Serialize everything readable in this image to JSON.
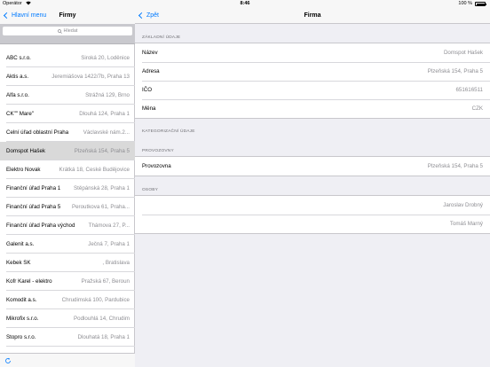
{
  "status_bar": {
    "carrier": "Operátor",
    "time": "8:46",
    "battery": "100 %"
  },
  "master": {
    "nav": {
      "back_label": "Hlavní menu",
      "title": "Firmy"
    },
    "search": {
      "placeholder": "Hledat"
    },
    "companies": [
      {
        "name": "ABC s.r.o.",
        "address": "Široká 20, Loděnice",
        "selected": false
      },
      {
        "name": "Aktis a.s.",
        "address": "Jeremiášova 1422/7b, Praha 13",
        "selected": false
      },
      {
        "name": "Alfa s.r.o.",
        "address": "Strážná 129, Brno",
        "selected": false
      },
      {
        "name": "CK\"\" Mare\"",
        "address": "Dlouhá 124, Praha 1",
        "selected": false
      },
      {
        "name": "Celní úřad oblastní Praha",
        "address": "Václavské nám.2...",
        "selected": false
      },
      {
        "name": "Domspot Hašek",
        "address": "Plzeňská 154, Praha 5",
        "selected": true
      },
      {
        "name": "Elektro Novak",
        "address": "Krátká 18, České Budějovice",
        "selected": false
      },
      {
        "name": "Finanční úřad Praha 1",
        "address": "Štěpánská 28, Praha 1",
        "selected": false
      },
      {
        "name": "Finanční úřad Praha 5",
        "address": "Peroutkova 61, Praha...",
        "selected": false
      },
      {
        "name": "Finanční úřad Praha východ",
        "address": "Thámova 27, P...",
        "selected": false
      },
      {
        "name": "Galenit a.s.",
        "address": "Ječná 7, Praha 1",
        "selected": false
      },
      {
        "name": "Kebek SK",
        "address": ", Bratislava",
        "selected": false
      },
      {
        "name": "Kofr Karel - elektro",
        "address": "Pražská 67, Beroun",
        "selected": false
      },
      {
        "name": "Komodit a.s.",
        "address": "Chrudimská 100, Pardubice",
        "selected": false
      },
      {
        "name": "Mikrofix s.r.o.",
        "address": "Podlouhlá 14, Chrudim",
        "selected": false
      },
      {
        "name": "Stopro s.r.o.",
        "address": "Dlouhatá 18, Praha 1",
        "selected": false
      }
    ]
  },
  "detail": {
    "nav": {
      "back_label": "Zpět",
      "title": "Firma"
    },
    "basic": {
      "header": "ZÁKLADNÍ ÚDAJE",
      "rows": [
        {
          "label": "Název",
          "value": "Domspot Hašek"
        },
        {
          "label": "Adresa",
          "value": "Plzeňská 154, Praha 5"
        },
        {
          "label": "IČO",
          "value": "651616511"
        },
        {
          "label": "Měna",
          "value": "CZK"
        }
      ]
    },
    "categorization": {
      "header": "KATEGORIZAČNÍ ÚDAJE"
    },
    "branches": {
      "header": "PROVOZOVNY",
      "rows": [
        {
          "label": "Provozovna",
          "value": "Plzeňská 154, Praha 5"
        }
      ]
    },
    "persons": {
      "header": "OSOBY",
      "rows": [
        {
          "label": "",
          "value": "Jaroslav Drobný"
        },
        {
          "label": "",
          "value": "Tomáš Marný"
        }
      ]
    }
  },
  "colors": {
    "accent": "#007aff",
    "selected_row": "#d9d9d9",
    "secondary_text": "#8e8e93",
    "background": "#efeff4"
  },
  "icons": {
    "back": "chevron-left-icon",
    "search": "search-icon",
    "refresh": "refresh-icon",
    "wifi": "wifi-icon",
    "battery": "battery-icon"
  }
}
